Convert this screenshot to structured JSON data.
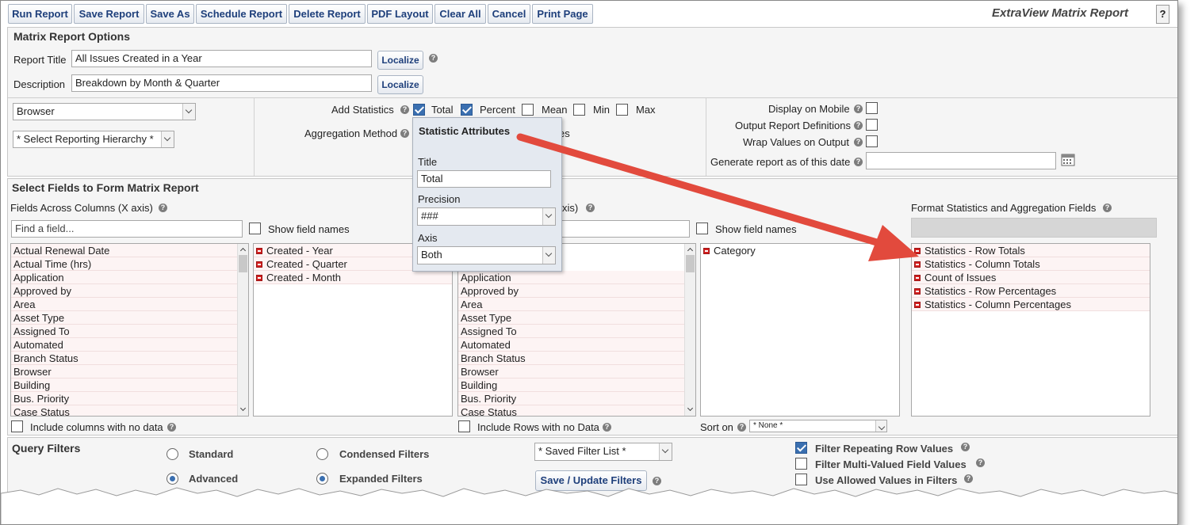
{
  "toolbar": {
    "buttons": [
      "Run Report",
      "Save Report",
      "Save As",
      "Schedule Report",
      "Delete Report",
      "PDF Layout",
      "Clear All",
      "Cancel",
      "Print Page"
    ],
    "app_title": "ExtraView Matrix Report",
    "help_label": "?"
  },
  "options": {
    "heading": "Matrix Report Options",
    "report_title_label": "Report Title",
    "report_title_value": "All Issues Created in a Year",
    "description_label": "Description",
    "description_value": "Breakdown by Month & Quarter",
    "localize_label": "Localize",
    "layout_select": "Browser",
    "hierarchy_select": "* Select Reporting Hierarchy *",
    "add_statistics_label": "Add Statistics",
    "stat_total": "Total",
    "stat_percent": "Percent",
    "stat_mean": "Mean",
    "stat_min": "Min",
    "stat_max": "Max",
    "aggregation_label": "Aggregation Method",
    "aggregation_partial": "es",
    "display_mobile": "Display on Mobile",
    "output_definitions": "Output Report Definitions",
    "wrap_values": "Wrap Values on Output",
    "generate_asof": "Generate report as of this date"
  },
  "popup": {
    "title": "Statistic Attributes",
    "title_label": "Title",
    "title_value": "Total",
    "precision_label": "Precision",
    "precision_value": "###",
    "axis_label": "Axis",
    "axis_value": "Both"
  },
  "fields": {
    "heading": "Select Fields to Form Matrix Report",
    "x_heading": "Fields Across Columns (X axis)",
    "y_heading_partial": "xis)",
    "format_heading": "Format Statistics and Aggregation Fields",
    "find_placeholder": "Find a field...",
    "show_field_names": "Show field names",
    "available": [
      "Actual Renewal Date",
      "Actual Time (hrs)",
      "Application",
      "Approved by",
      "Area",
      "Asset Type",
      "Assigned To",
      "Automated",
      "Branch Status",
      "Browser",
      "Building",
      "Bus. Priority",
      "Case Status"
    ],
    "available_y": [
      "Application",
      "Approved by",
      "Area",
      "Asset Type",
      "Assigned To",
      "Automated",
      "Branch Status",
      "Browser",
      "Building",
      "Bus. Priority",
      "Case Status"
    ],
    "x_selected": [
      "Created - Year",
      "Created - Quarter",
      "Created - Month"
    ],
    "y_selected": [
      "Category"
    ],
    "stats_selected": [
      "Statistics - Row Totals",
      "Statistics - Column Totals",
      "Count of Issues",
      "Statistics - Row Percentages",
      "Statistics - Column Percentages"
    ],
    "include_cols": "Include columns with no data",
    "include_rows": "Include Rows with no Data",
    "sort_on": "Sort on",
    "sort_value": "* None *"
  },
  "filters": {
    "heading": "Query Filters",
    "standard": "Standard",
    "advanced": "Advanced",
    "condensed": "Condensed Filters",
    "expanded": "Expanded Filters",
    "saved_list": "* Saved Filter List *",
    "save_update": "Save / Update Filters",
    "filter_repeating": "Filter Repeating Row Values",
    "filter_multi": "Filter Multi-Valued Field Values",
    "use_allowed": "Use Allowed Values in Filters"
  },
  "colors": {
    "accent": "#3a6fb0",
    "label_red": "#b31b1b",
    "button_text": "#1e3f7b",
    "arrow": "#e24a3d"
  }
}
